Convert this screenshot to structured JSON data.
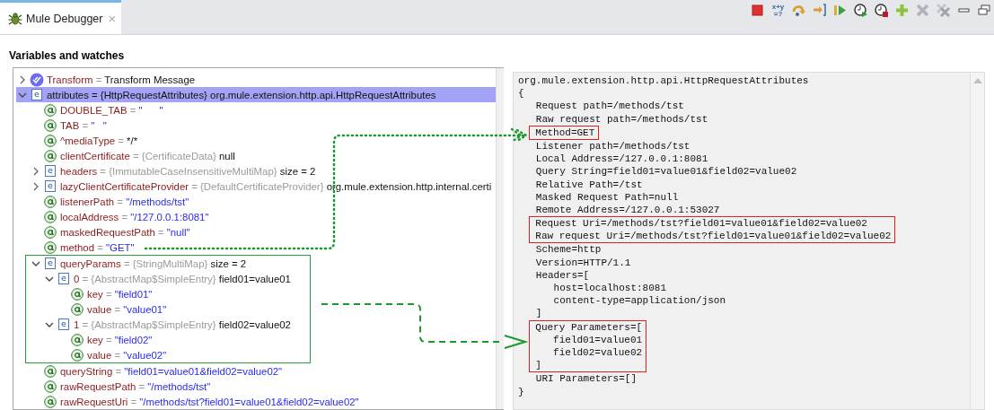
{
  "tabs": [
    {
      "label": "Mule Debugger",
      "close": "×",
      "selected": true
    }
  ],
  "toolbar": [
    {
      "kind": "stop"
    },
    {
      "kind": "evaluate",
      "glyph": [
        "x+y",
        "=?"
      ]
    },
    {
      "kind": "step-over"
    },
    {
      "kind": "step-into"
    },
    {
      "kind": "resume"
    },
    {
      "kind": "clock-go"
    },
    {
      "kind": "clock-stop"
    },
    {
      "kind": "add"
    },
    {
      "kind": "remove"
    },
    {
      "kind": "remove-all"
    },
    {
      "kind": "minimize"
    },
    {
      "kind": "restore"
    }
  ],
  "section_title": "Variables and watches",
  "tree": [
    {
      "kind": "flow",
      "name": "Transform",
      "sep": "=",
      "value": "Transform Message",
      "expanded": false,
      "selected": false,
      "highlighted": false
    },
    {
      "kind": "object",
      "glyph": "e",
      "name": "attributes",
      "sep": "=",
      "type": "{HttpRequestAttributes}",
      "value": "org.mule.extension.http.api.HttpRequestAttributes",
      "expanded": true,
      "selected": true,
      "highlighted": false,
      "children": [
        {
          "kind": "attribute",
          "name": "DOUBLE_TAB",
          "sep": "=",
          "string": "\"      \"",
          "selected": false,
          "highlighted": false
        },
        {
          "kind": "attribute",
          "name": "TAB",
          "sep": "=",
          "string": "\"   \"",
          "selected": false,
          "highlighted": false
        },
        {
          "kind": "attribute",
          "name": "^mediaType",
          "sep": "=",
          "value": "*/*",
          "selected": false,
          "highlighted": false
        },
        {
          "kind": "attribute",
          "name": "clientCertificate",
          "sep": "=",
          "type": "{CertificateData}",
          "value": "null",
          "selected": false,
          "highlighted": false
        },
        {
          "kind": "object",
          "glyph": "e",
          "name": "headers",
          "sep": "=",
          "type": "{ImmutableCaseInsensitiveMultiMap}",
          "value": "size = 2",
          "expanded": false,
          "selected": false,
          "highlighted": false
        },
        {
          "kind": "object",
          "glyph": "e",
          "name": "lazyClientCertificateProvider",
          "sep": "=",
          "type": "{DefaultCertificateProvider}",
          "value": "org.mule.extension.http.internal.certi",
          "expanded": false,
          "selected": false,
          "highlighted": false
        },
        {
          "kind": "attribute",
          "name": "listenerPath",
          "sep": "=",
          "string": "\"/methods/tst\"",
          "selected": false,
          "highlighted": false
        },
        {
          "kind": "attribute",
          "name": "localAddress",
          "sep": "=",
          "string": "\"/127.0.0.1:8081\"",
          "selected": false,
          "highlighted": false
        },
        {
          "kind": "attribute",
          "name": "maskedRequestPath",
          "sep": "=",
          "string": "\"null\"",
          "selected": false,
          "highlighted": false
        },
        {
          "kind": "attribute",
          "name": "method",
          "sep": "=",
          "string": "\"GET\"",
          "selected": false,
          "highlighted": false
        },
        {
          "kind": "object",
          "glyph": "e",
          "name": "queryParams",
          "sep": "=",
          "type": "{StringMultiMap}",
          "value": "size = 2",
          "expanded": true,
          "selected": false,
          "highlighted": true,
          "children": [
            {
              "kind": "object",
              "glyph": "e",
              "name": "0",
              "sep": "=",
              "type": "{AbstractMap$SimpleEntry}",
              "value": "field01=value01",
              "expanded": true,
              "selected": false,
              "highlighted": false,
              "children": [
                {
                  "kind": "attribute",
                  "name": "key",
                  "sep": "=",
                  "string": "\"field01\"",
                  "selected": false,
                  "highlighted": false
                },
                {
                  "kind": "attribute",
                  "name": "value",
                  "sep": "=",
                  "string": "\"value01\"",
                  "selected": false,
                  "highlighted": false
                }
              ]
            },
            {
              "kind": "object",
              "glyph": "e",
              "name": "1",
              "sep": "=",
              "type": "{AbstractMap$SimpleEntry}",
              "value": "field02=value02",
              "expanded": true,
              "selected": false,
              "highlighted": false,
              "children": [
                {
                  "kind": "attribute",
                  "name": "key",
                  "sep": "=",
                  "string": "\"field02\"",
                  "selected": false,
                  "highlighted": false
                },
                {
                  "kind": "attribute",
                  "name": "value",
                  "sep": "=",
                  "string": "\"value02\"",
                  "selected": false,
                  "highlighted": false
                }
              ]
            }
          ]
        },
        {
          "kind": "attribute",
          "name": "queryString",
          "sep": "=",
          "string": "\"field01=value01&field02=value02\"",
          "selected": false,
          "highlighted": false
        },
        {
          "kind": "attribute",
          "name": "rawRequestPath",
          "sep": "=",
          "string": "\"/methods/tst\"",
          "selected": false,
          "highlighted": false
        },
        {
          "kind": "attribute",
          "name": "rawRequestUri",
          "sep": "=",
          "string": "\"/methods/tst?field01=value01&field02=value02\"",
          "selected": false,
          "highlighted": false
        }
      ]
    }
  ],
  "detail": [
    {
      "boxed": false,
      "lines": [
        "org.mule.extension.http.api.HttpRequestAttributes",
        "{",
        "   Request path=/methods/tst",
        "   Raw request path=/methods/tst"
      ]
    },
    {
      "boxed": true,
      "lines": [
        "   Method=GET"
      ]
    },
    {
      "boxed": false,
      "lines": [
        "   Listener path=/methods/tst",
        "   Local Address=/127.0.0.1:8081",
        "   Query String=field01=value01&field02=value02",
        "   Relative Path=/tst",
        "   Masked Request Path=null",
        "   Remote Address=/127.0.0.1:53027"
      ]
    },
    {
      "boxed": true,
      "lines": [
        "   Request Uri=/methods/tst?field01=value01&field02=value02",
        "   Raw request Uri=/methods/tst?field01=value01&field02=value02"
      ]
    },
    {
      "boxed": false,
      "lines": [
        "   Scheme=http",
        "   Version=HTTP/1.1",
        "   Headers=[",
        "      host=localhost:8081",
        "      content-type=application/json",
        "   ]"
      ]
    },
    {
      "boxed": true,
      "lines": [
        "   Query Parameters=[",
        "      field01=value01",
        "      field02=value02",
        "   ]"
      ]
    },
    {
      "boxed": false,
      "lines": [
        "   URI Parameters=[]",
        "}"
      ]
    }
  ]
}
